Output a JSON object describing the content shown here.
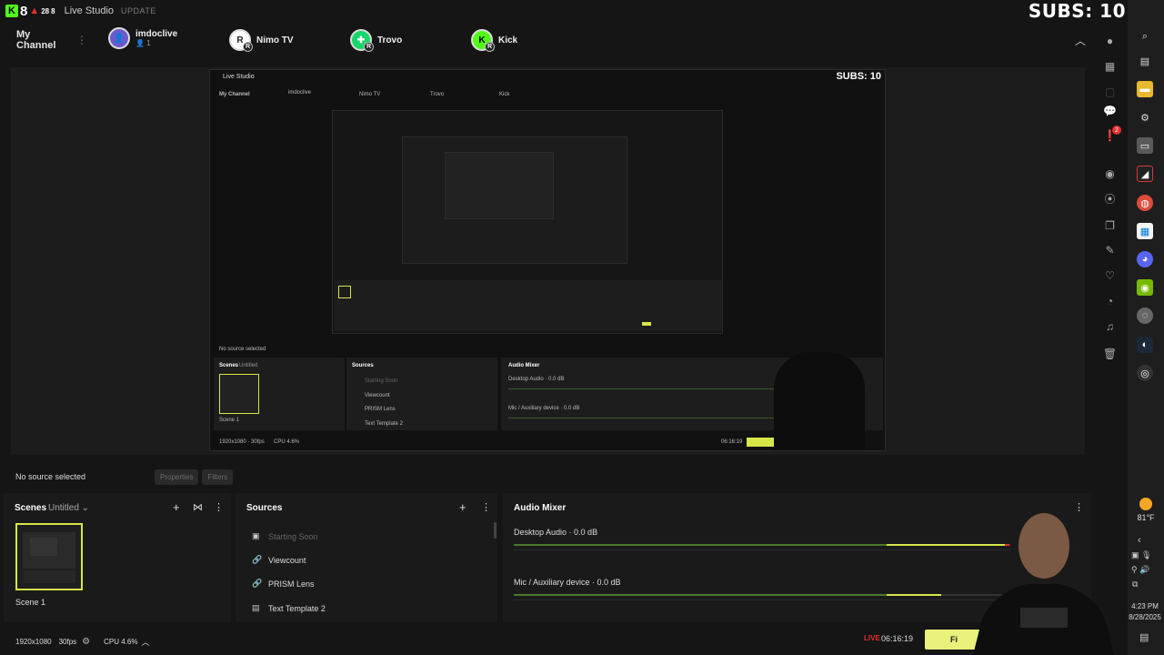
{
  "titlebar": {
    "counter_a": "8",
    "counter_b": "28",
    "counter_c": "8",
    "app_title": "Live Studio",
    "update_label": "UPDATE",
    "subs_label": "SUBS: 10"
  },
  "channels": {
    "my_channel_label": "My Channel",
    "items": [
      {
        "name": "imdoclive",
        "sub": "1",
        "badge": ""
      },
      {
        "name": "Nimo TV",
        "sub": "",
        "badge": "R"
      },
      {
        "name": "Trovo",
        "sub": "",
        "badge": "R"
      },
      {
        "name": "Kick",
        "sub": "",
        "badge": "R"
      }
    ]
  },
  "sourcebar": {
    "no_source_label": "No source selected",
    "properties_label": "Properties",
    "filters_label": "Filters"
  },
  "scenes": {
    "title": "Scenes",
    "collection": "Untitled",
    "items": [
      {
        "name": "Scene 1"
      }
    ]
  },
  "sources": {
    "title": "Sources",
    "items": [
      {
        "name": "Starting Soon",
        "icon": "image-icon"
      },
      {
        "name": "Viewcount",
        "icon": "link-icon"
      },
      {
        "name": "PRISM Lens",
        "icon": "link-icon"
      },
      {
        "name": "Text Template 2",
        "icon": "text-template-icon"
      }
    ]
  },
  "mixer": {
    "title": "Audio Mixer",
    "tracks": [
      {
        "name": "Desktop Audio",
        "level": "0.0 dB"
      },
      {
        "name": "Mic / Auxiliary device",
        "level": "0.0 dB"
      }
    ]
  },
  "statusbar": {
    "resolution": "1920x1080",
    "fps": "30fps",
    "cpu": "CPU 4.6%",
    "live_label": "LIVE",
    "live_time": "06:16:19",
    "finish_label": "Fi"
  },
  "taskbar": {
    "weather_temp": "81°F",
    "time": "4:23 PM",
    "date": "8/28/2025",
    "notif_count": "2"
  },
  "nested": {
    "app_title": "Live Studio",
    "subs": "SUBS: 10",
    "my_channel": "My Channel",
    "imdoclive": "imdoclive",
    "nimo": "Nimo TV",
    "trovo": "Trovo",
    "kick": "Kick",
    "no_source": "No source selected",
    "scenes": "Scenes",
    "untitled": "Untitled",
    "sources": "Sources",
    "audio_mixer": "Audio Mixer",
    "desktop_audio": "Desktop Audio · 0.0 dB",
    "mic_aux": "Mic / Auxiliary device · 0.0 dB",
    "starting_soon": "Starting Soon",
    "viewcount": "Viewcount",
    "prism_lens": "PRISM Lens",
    "text_template": "Text Template 2",
    "scene1": "Scene 1",
    "res": "1920x1080 · 30fps",
    "cpu": "CPU 4.6%",
    "live_time": "06:16:19"
  },
  "colors": {
    "accent_yellow": "#d6e64a",
    "kick_green": "#53fc18",
    "live_red": "#e83030"
  }
}
